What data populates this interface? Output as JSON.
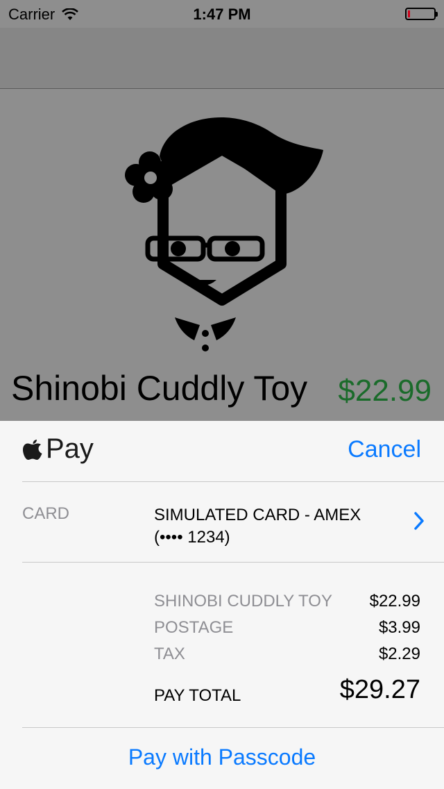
{
  "status_bar": {
    "carrier": "Carrier",
    "time": "1:47 PM",
    "icons": [
      "wifi-icon",
      "battery-icon"
    ]
  },
  "product": {
    "name": "Shinobi Cuddly Toy",
    "price": "$22.99",
    "price_color": "#1a6b2a",
    "image_icon": "shinobi-character-illustration"
  },
  "apple_pay": {
    "logo_text": "Pay",
    "logo_icon": "apple-icon",
    "cancel_label": "Cancel",
    "card": {
      "label": "CARD",
      "value_line1": "SIMULATED CARD - AMEX",
      "value_line2": "(•••• 1234)"
    },
    "summary": {
      "items": [
        {
          "label": "SHINOBI CUDDLY TOY",
          "amount": "$22.99"
        },
        {
          "label": "POSTAGE",
          "amount": "$3.99"
        },
        {
          "label": "TAX",
          "amount": "$2.29"
        }
      ],
      "total_label": "PAY TOTAL",
      "total_amount": "$29.27"
    },
    "passcode_label": "Pay with Passcode",
    "accent_color": "#0a7aff"
  }
}
